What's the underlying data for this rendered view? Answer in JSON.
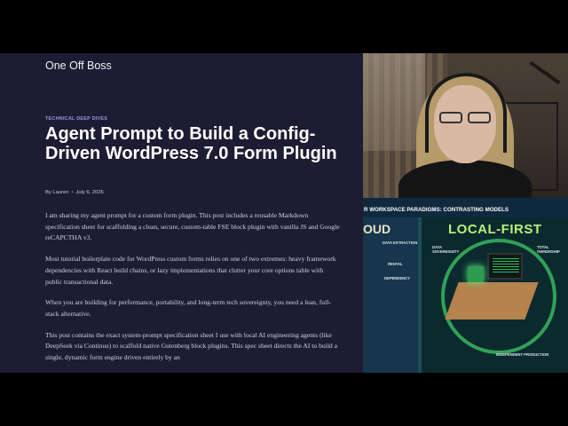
{
  "blog": {
    "site_title": "One Off Boss",
    "category": "TECHNICAL DEEP DIVES",
    "title": "Agent Prompt to Build a Config-Driven WordPress 7.0 Form Plugin",
    "author": "By Lauren",
    "separator": "•",
    "date": "July 6, 2026",
    "paragraphs": [
      "I am sharing my agent prompt for a custom form plugin. This post includes a reusable Markdown specification sheet for scaffolding a clean, secure, custom-table FSE block plugin with vanilla JS and Google reCAPCTHA v3.",
      "Most tutorial boilerplate code for WordPress custom forms relies on one of two extremes: heavy framework dependencies with React build chains, or lazy implementations that clutter your core options table with public transactional data.",
      "When you are building for performance, portability, and long-term tech sovereignty, you need a lean, full-stack alternative.",
      "This post contains the exact system-prompt specification sheet I use with local AI engineering agents (like DeepSeek via Continue) to scaffold native Gutenberg block plugins. This spec sheet directs the AI to build a single, dynamic form engine driven entirely by an"
    ]
  },
  "infographic": {
    "header": "R WORKSPACE PARADIGMS: CONTRASTING MODELS",
    "cloud_label": "OUD",
    "local_label": "LOCAL-FIRST",
    "cloud_tags": [
      "DATA\nEXTRACTION",
      "RENTAL",
      "DEPENDENCY"
    ],
    "local_tags": [
      "DATA\nSOVEREIGNTY",
      "TOTAL\nOWNERSHIP",
      "INDEPENDENT\nPRODUCTION"
    ]
  },
  "colors": {
    "blog_bg": "#1d1c33",
    "accent": "#9a93e8",
    "local_green": "#b6f07c"
  }
}
